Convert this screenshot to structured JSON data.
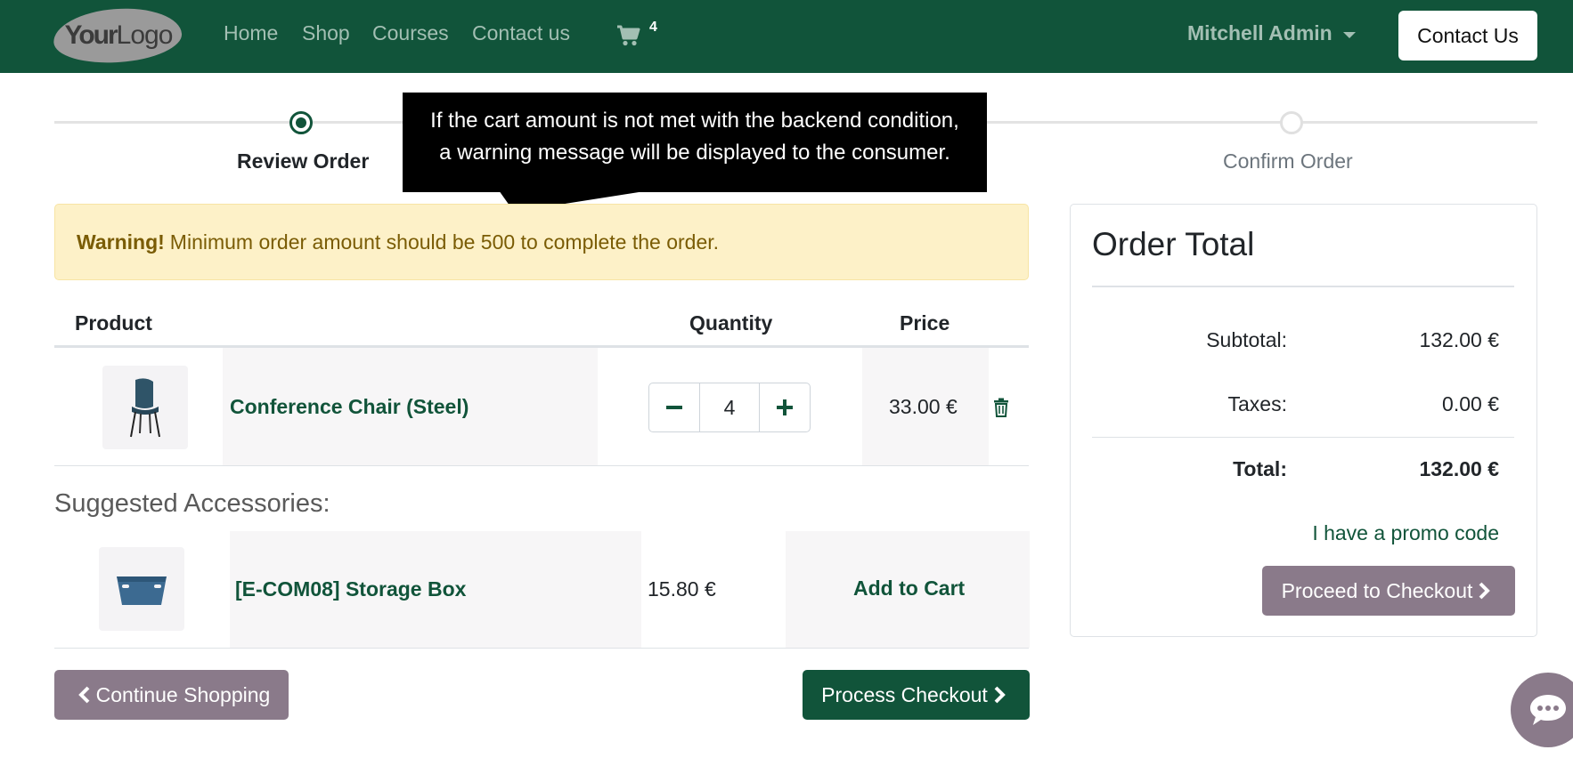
{
  "navbar": {
    "logo_text_bold": "Your",
    "logo_text_light": "Logo",
    "links": [
      "Home",
      "Shop",
      "Courses",
      "Contact us"
    ],
    "cart_count": "4",
    "user_name": "Mitchell Admin",
    "contact_button": "Contact Us"
  },
  "wizard": {
    "step_review": "Review Order",
    "step_confirm": "Confirm Order"
  },
  "tooltip": {
    "line1": "If the cart amount is not met with the backend condition,",
    "line2": "a warning message will be displayed to the consumer."
  },
  "warning": {
    "strong": "Warning!",
    "message": "Minimum order amount should be 500 to complete the order."
  },
  "cart_table": {
    "headers": [
      "Product",
      "Quantity",
      "Price"
    ],
    "rows": [
      {
        "name": "Conference Chair (Steel)",
        "quantity": "4",
        "price": "33.00 €"
      }
    ]
  },
  "accessories": {
    "title": "Suggested Accessories:",
    "items": [
      {
        "name": "[E-COM08] Storage Box",
        "price": "15.80 €",
        "action": "Add to Cart"
      }
    ]
  },
  "buttons": {
    "continue_shopping": "Continue Shopping",
    "process_checkout": "Process Checkout"
  },
  "order_total": {
    "title": "Order Total",
    "subtotal_label": "Subtotal:",
    "subtotal_value": "132.00 €",
    "taxes_label": "Taxes:",
    "taxes_value": "0.00 €",
    "total_label": "Total:",
    "total_value": "132.00 €",
    "promo_link": "I have a promo code",
    "checkout_button": "Proceed to Checkout"
  },
  "colors": {
    "brand": "#11543a",
    "muted_button": "#8a7a8a",
    "warning_bg": "#fdf1c8"
  }
}
